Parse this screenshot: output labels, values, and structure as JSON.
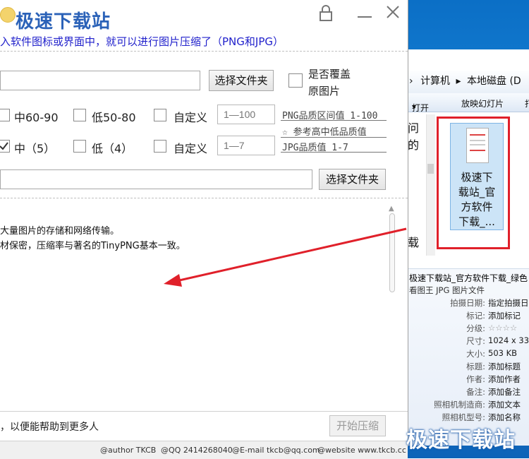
{
  "app": {
    "brand": "极速下载站",
    "description": "入软件图标或界面中，就可以进行图片压缩了（PNG和JPG）",
    "select_folder_label": "选择文件夹",
    "overwrite_label_1": "是否覆盖",
    "overwrite_label_2": "原图片",
    "png_options": [
      "中60-90",
      "低50-80",
      "自定义"
    ],
    "png_custom_placeholder": "1—100",
    "png_hint": "PNG品质区间值 1-100",
    "png_hint2": "☆ 参考高中低品质值",
    "jpg_options": [
      "中（5）",
      "低（4）",
      "自定义"
    ],
    "jpg_custom_placeholder": "1—7",
    "jpg_hint": "JPG品质值 1-7",
    "output_select_folder_label": "选择文件夹",
    "info_lines": [
      "大量图片的存储和网络传输。",
      "材保密，压缩率与著名的TinyPNG基本一致。"
    ],
    "status_text": "，以便能帮助到更多人",
    "start_button": "开始压缩",
    "credits": {
      "author": "@author TKCB",
      "qq": "@QQ 2414268040",
      "email": "@E-mail tkcb@qq.com",
      "website": "@website www.tkcb.cc"
    }
  },
  "explorer": {
    "address_computer": "计算机",
    "address_disk": "本地磁盘 (D",
    "toolbar": [
      "打开",
      "放映幻灯片",
      "打"
    ],
    "left_fragment_1": "问的",
    "left_fragment_2": "载",
    "file_label": [
      "极速下",
      "载站_官",
      "方软件",
      "下载_..."
    ],
    "details_title": "极速下载站_官方软件下载_绿色",
    "details_type": "看图王 JPG 图片文件",
    "details": [
      {
        "k": "拍摄日期:",
        "v": "指定拍摄日"
      },
      {
        "k": "标记:",
        "v": "添加标记"
      },
      {
        "k": "分级:",
        "v": "☆☆☆☆"
      },
      {
        "k": "尺寸:",
        "v": "1024 x 33"
      },
      {
        "k": "大小:",
        "v": "503 KB"
      },
      {
        "k": "标题:",
        "v": "添加标题"
      },
      {
        "k": "作者:",
        "v": "添加作者"
      },
      {
        "k": "备注:",
        "v": "添加备注"
      },
      {
        "k": "照相机制造商:",
        "v": "添加文本"
      },
      {
        "k": "照相机型号:",
        "v": "添加名称"
      }
    ]
  },
  "watermark": "极速下载站",
  "colors": {
    "brand": "#2b62b8",
    "description": "#2222cc",
    "highlight_box": "#e0202a",
    "arrow": "#e0202a"
  }
}
